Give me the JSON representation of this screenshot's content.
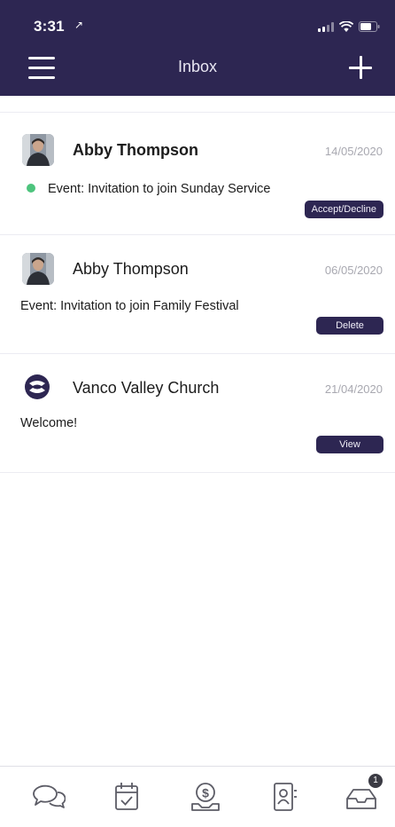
{
  "status_bar": {
    "time": "3:31",
    "location_arrow": "↗"
  },
  "header": {
    "title": "Inbox",
    "menu_icon": "hamburger-icon",
    "add_icon": "plus-icon"
  },
  "colors": {
    "header_bg": "#2d2652",
    "button_bg": "#2d2652",
    "unread_dot": "#4dc47d",
    "date_text": "#a8a8b0"
  },
  "inbox": [
    {
      "sender": "Abby Thompson",
      "date": "14/05/2020",
      "message": "Event: Invitation to join Sunday Service",
      "action": "Accept/Decline",
      "unread": true,
      "avatar": "person-photo"
    },
    {
      "sender": "Abby Thompson",
      "date": "06/05/2020",
      "message": "Event: Invitation to join Family Festival",
      "action": "Delete",
      "unread": false,
      "avatar": "person-photo"
    },
    {
      "sender": "Vanco Valley Church",
      "date": "21/04/2020",
      "message": "Welcome!",
      "action": "View",
      "unread": false,
      "avatar": "church-logo"
    }
  ],
  "tabbar": {
    "tabs": [
      {
        "name": "messages",
        "icon": "chat-bubbles-icon"
      },
      {
        "name": "calendar",
        "icon": "calendar-check-icon"
      },
      {
        "name": "giving",
        "icon": "dollar-hand-icon"
      },
      {
        "name": "directory",
        "icon": "contact-card-icon"
      },
      {
        "name": "inbox",
        "icon": "inbox-tray-icon",
        "badge": "1"
      }
    ]
  }
}
